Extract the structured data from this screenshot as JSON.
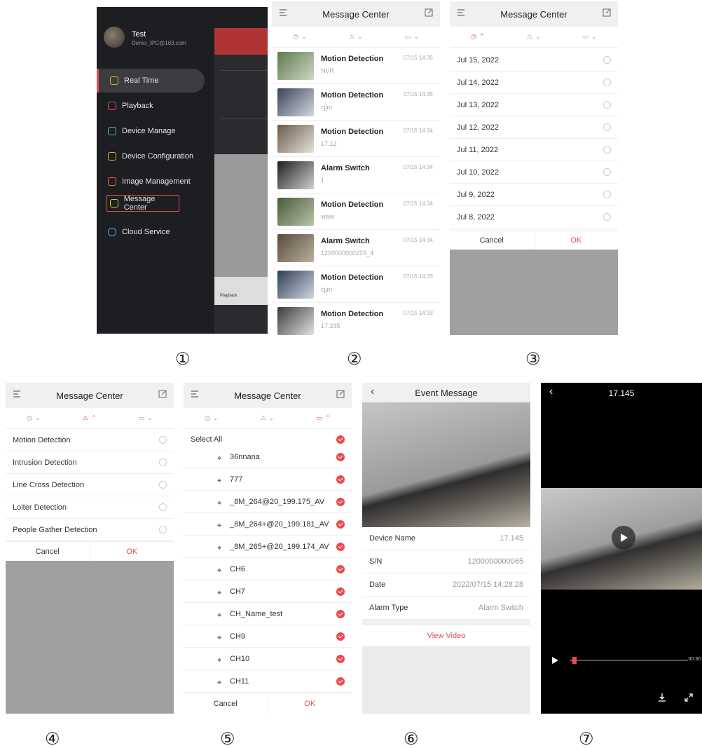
{
  "p1": {
    "user_name": "Test",
    "user_email": "Demo_IPC@163.com",
    "menu": [
      {
        "label": "Real Time",
        "icon": "play-square-icon",
        "color": "#e8a33d"
      },
      {
        "label": "Playback",
        "icon": "film-icon",
        "color": "#e84c4c"
      },
      {
        "label": "Device Manage",
        "icon": "camera-icon",
        "color": "#3dbfa0"
      },
      {
        "label": "Device Configuration",
        "icon": "config-icon",
        "color": "#e8a33d"
      },
      {
        "label": "Image Management",
        "icon": "image-icon",
        "color": "#e86a3d"
      },
      {
        "label": "Message Center",
        "icon": "chat-icon",
        "color": "#b6d23d"
      },
      {
        "label": "Cloud Service",
        "icon": "cloud-icon",
        "color": "#4aa3e8"
      }
    ],
    "bg_tabs": [
      "Playback"
    ]
  },
  "p2": {
    "title": "Message Center",
    "messages": [
      {
        "title": "Motion Detection",
        "sub": "NVR",
        "date": "07/15 14:35"
      },
      {
        "title": "Motion Detection",
        "sub": "cjjm",
        "date": "07/15 14:35"
      },
      {
        "title": "Motion Detection",
        "sub": "17.12",
        "date": "07/15 14:34"
      },
      {
        "title": "Alarm Switch",
        "sub": "1",
        "date": "07/15 14:34"
      },
      {
        "title": "Motion Detection",
        "sub": "www",
        "date": "07/15 14:34"
      },
      {
        "title": "Alarm Switch",
        "sub": "1200000000229_4",
        "date": "07/15 14:34"
      },
      {
        "title": "Motion Detection",
        "sub": "cjjm",
        "date": "07/15 14:33"
      },
      {
        "title": "Motion Detection",
        "sub": "17.235",
        "date": "07/15 14:33"
      }
    ]
  },
  "p3": {
    "title": "Message Center",
    "dates": [
      "Jul 15, 2022",
      "Jul 14, 2022",
      "Jul 13, 2022",
      "Jul 12, 2022",
      "Jul 11, 2022",
      "Jul 10, 2022",
      "Jul 9, 2022",
      "Jul 8, 2022"
    ],
    "cancel": "Cancel",
    "ok": "OK"
  },
  "p4": {
    "title": "Message Center",
    "types": [
      "Motion Detection",
      "Intrusion Detection",
      "Line Cross Detection",
      "Loiter Detection",
      "People Gather Detection"
    ],
    "cancel": "Cancel",
    "ok": "OK"
  },
  "p5": {
    "title": "Message Center",
    "select_all": "Select All",
    "channels": [
      "36nnana",
      "777",
      "_8M_264@20_199.175_AV",
      "_8M_264+@20_199.181_AV",
      "_8M_265+@20_199.174_AV",
      "CH6",
      "CH7",
      "CH_Name_test",
      "CH9",
      "CH10",
      "CH11"
    ],
    "cancel": "Cancel",
    "ok": "OK"
  },
  "p6": {
    "title": "Event Message",
    "details": [
      {
        "label": "Device Name",
        "value": "17.145"
      },
      {
        "label": "S/N",
        "value": "1200000000065"
      },
      {
        "label": "Date",
        "value": "2022/07/15 14:28:28"
      },
      {
        "label": "Alarm Type",
        "value": "Alarm Switch"
      }
    ],
    "view_video": "View Video"
  },
  "p7": {
    "title": "17.145",
    "duration": "00:30",
    "progress": 0.02
  },
  "labels": [
    "①",
    "②",
    "③",
    "④",
    "⑤",
    "⑥",
    "⑦"
  ],
  "colors": {
    "accent": "#e84c4c",
    "sidebar_bg": "#1c1e22",
    "header_bg": "#f0f0f0",
    "overlay_gray": "#a0a0a0"
  }
}
